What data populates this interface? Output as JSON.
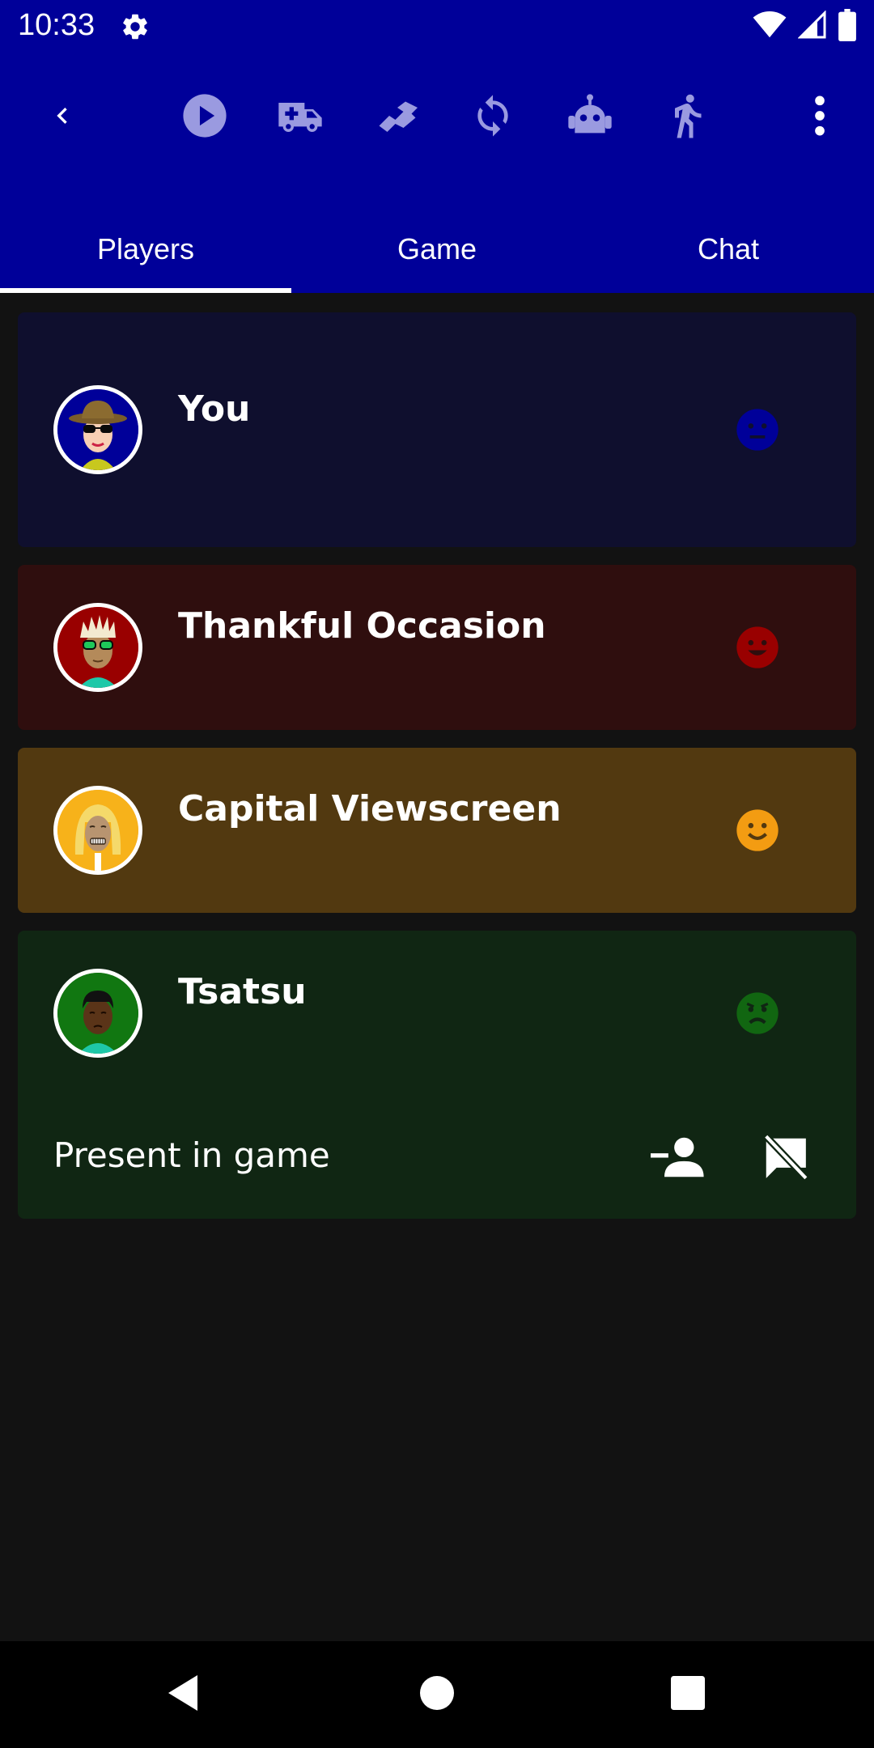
{
  "status_bar": {
    "time": "10:33",
    "icons": [
      "settings-icon",
      "wifi-icon",
      "signal-icon",
      "battery-icon"
    ]
  },
  "toolbar": {
    "icons": [
      "back-icon",
      "play-icon",
      "ambulance-icon",
      "handshake-icon",
      "sync-icon",
      "robot-icon",
      "walk-icon",
      "more-vert-icon"
    ]
  },
  "tabs": [
    {
      "label": "Players",
      "selected": true
    },
    {
      "label": "Game",
      "selected": false
    },
    {
      "label": "Chat",
      "selected": false
    }
  ],
  "players": [
    {
      "name": "You",
      "color": "#0f0f2e",
      "mood_color": "#000099",
      "mood": "neutral-face-icon"
    },
    {
      "name": "Thankful Occasion",
      "color": "#2f0e0e",
      "mood_color": "#990000",
      "mood": "happy-face-icon"
    },
    {
      "name": "Capital Viewscreen",
      "color": "#523910",
      "mood_color": "#f39c12",
      "mood": "smile-face-icon"
    },
    {
      "name": "Tsatsu",
      "color": "#102613",
      "mood_color": "#116611",
      "mood": "angry-face-icon",
      "status": "Present in game",
      "actions": [
        "add-friend-icon",
        "chat-off-icon"
      ]
    }
  ],
  "colors": {
    "header": "#000099",
    "background": "#121212",
    "toolbar_icon": "#9a9ae0"
  }
}
